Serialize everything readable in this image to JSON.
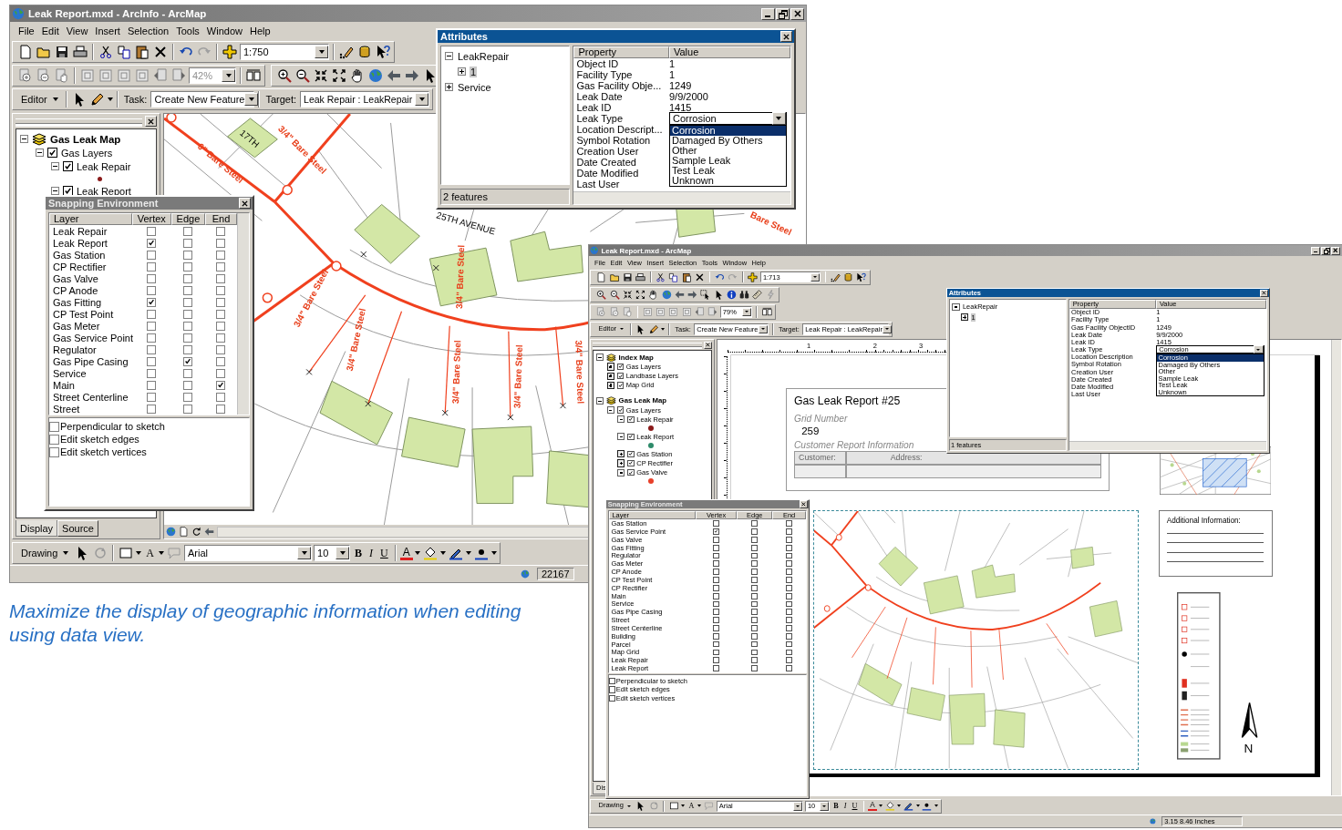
{
  "windows": [
    {
      "kind": "data",
      "title": "Leak Report.mxd - ArcInfo - ArcMap",
      "menu": [
        "File",
        "Edit",
        "View",
        "Insert",
        "Selection",
        "Tools",
        "Window",
        "Help"
      ],
      "scale": "1:750",
      "zoom": "42%",
      "editor": {
        "menu": "Editor",
        "task_label": "Task:",
        "task": "Create New Feature",
        "target_label": "Target:",
        "target": "Leak Repair : LeakRepair"
      },
      "toc": {
        "items": [
          {
            "kind": "frame",
            "label": "Gas Leak Map",
            "expanded": true,
            "children": [
              {
                "kind": "layer",
                "label": "Gas Layers",
                "checked": true,
                "expanded": true,
                "children": [
                  {
                    "kind": "layer",
                    "label": "Leak Repair",
                    "checked": true,
                    "expanded": true,
                    "children": [
                      {
                        "kind": "symbol",
                        "color": "#8b1a1a"
                      }
                    ]
                  },
                  {
                    "kind": "layer",
                    "label": "Leak Report",
                    "checked": true,
                    "expanded": true
                  }
                ]
              }
            ]
          }
        ]
      },
      "toc_tabs": [
        {
          "label": "Display",
          "selected": true
        },
        {
          "label": "Source",
          "selected": false
        }
      ],
      "map_labels": [
        {
          "text": "6\" Bare Steel",
          "kind": "pipe"
        },
        {
          "text": "17TH",
          "kind": "street"
        },
        {
          "text": "3/4\" Bare Steel",
          "kind": "pipe"
        },
        {
          "text": "25TH AVENUE",
          "kind": "street"
        },
        {
          "text": "3/4\" Bare Steel",
          "kind": "pipe"
        },
        {
          "text": "3/4\" Bare Steel",
          "kind": "pipe"
        },
        {
          "text": "3/4\" Bare Steel",
          "kind": "pipe"
        },
        {
          "text": "3/4\" Bare Steel",
          "kind": "pipe"
        },
        {
          "text": "3/4\" Bare Steel",
          "kind": "pipe"
        },
        {
          "text": "3/4\" Bare Steel",
          "kind": "pipe"
        },
        {
          "text": "Bare Steel",
          "kind": "pipe"
        }
      ],
      "drawing": {
        "menu": "Drawing",
        "text_tool": "A",
        "font": "Arial",
        "size": "10",
        "bold": "B",
        "italic": "I",
        "underline": "U",
        "font_color": "A"
      },
      "status": "22167",
      "attributes": {
        "title": "Attributes",
        "tree": [
          {
            "label": "LeakRepair",
            "expanded": true,
            "selected": false,
            "children": [
              {
                "label": "1",
                "expanded": false,
                "selected": true
              }
            ]
          },
          {
            "label": "Service",
            "expanded": false,
            "selected": false
          }
        ],
        "count": "2 features",
        "columns": [
          "Property",
          "Value"
        ],
        "rows": [
          {
            "property": "Object ID",
            "kind": "text",
            "value": "1"
          },
          {
            "property": "Facility Type",
            "kind": "text",
            "value": "1"
          },
          {
            "property": "Gas Facility Obje...",
            "kind": "text",
            "value": "1249"
          },
          {
            "property": "Leak Date",
            "kind": "text",
            "value": "9/9/2000"
          },
          {
            "property": "Leak ID",
            "kind": "text",
            "value": "1415"
          },
          {
            "property": "Leak Type",
            "kind": "dropdown",
            "value": "Corrosion",
            "options": [
              {
                "label": "Corrosion",
                "selected": true
              },
              {
                "label": "Damaged By Others",
                "selected": false
              },
              {
                "label": "Other",
                "selected": false
              },
              {
                "label": "Sample Leak",
                "selected": false
              },
              {
                "label": "Test Leak",
                "selected": false
              },
              {
                "label": "Unknown",
                "selected": false
              }
            ]
          },
          {
            "property": "Location Descript...",
            "kind": "text"
          },
          {
            "property": "Symbol Rotation",
            "kind": "text"
          },
          {
            "property": "Creation User",
            "kind": "text"
          },
          {
            "property": "Date Created",
            "kind": "text"
          },
          {
            "property": "Date Modified",
            "kind": "text"
          },
          {
            "property": "Last User",
            "kind": "text"
          }
        ]
      },
      "snapping": {
        "title": "Snapping Environment",
        "columns": [
          "Layer",
          "Vertex",
          "Edge",
          "End"
        ],
        "rows": [
          {
            "layer": "Leak Repair",
            "vertex": false,
            "edge": false,
            "end": false
          },
          {
            "layer": "Leak Report",
            "vertex": true,
            "edge": false,
            "end": false
          },
          {
            "layer": "Gas Station",
            "vertex": false,
            "edge": false,
            "end": false
          },
          {
            "layer": "CP Rectifier",
            "vertex": false,
            "edge": false,
            "end": false
          },
          {
            "layer": "Gas Valve",
            "vertex": false,
            "edge": false,
            "end": false
          },
          {
            "layer": "CP Anode",
            "vertex": false,
            "edge": false,
            "end": false
          },
          {
            "layer": "Gas Fitting",
            "vertex": true,
            "edge": false,
            "end": false
          },
          {
            "layer": "CP Test Point",
            "vertex": false,
            "edge": false,
            "end": false
          },
          {
            "layer": "Gas Meter",
            "vertex": false,
            "edge": false,
            "end": false
          },
          {
            "layer": "Gas Service Point",
            "vertex": false,
            "edge": false,
            "end": false
          },
          {
            "layer": "Regulator",
            "vertex": false,
            "edge": false,
            "end": false
          },
          {
            "layer": "Gas Pipe Casing",
            "vertex": false,
            "edge": true,
            "end": false
          },
          {
            "layer": "Service",
            "vertex": false,
            "edge": false,
            "end": false
          },
          {
            "layer": "Main",
            "vertex": false,
            "edge": false,
            "end": true
          },
          {
            "layer": "Street Centerline",
            "vertex": false,
            "edge": false,
            "end": false
          },
          {
            "layer": "Street",
            "vertex": false,
            "edge": false,
            "end": false
          }
        ],
        "options": [
          {
            "label": "Perpendicular to sketch",
            "checked": false
          },
          {
            "label": "Edit sketch edges",
            "checked": false
          },
          {
            "label": "Edit sketch vertices",
            "checked": false
          }
        ]
      }
    },
    {
      "kind": "layout",
      "title": "Leak Report.mxd - ArcMap",
      "menu": [
        "File",
        "Edit",
        "View",
        "Insert",
        "Selection",
        "Tools",
        "Window",
        "Help"
      ],
      "scale": "1:713",
      "zoom": "79%",
      "editor": {
        "menu": "Editor",
        "task_label": "Task:",
        "task": "Create New Feature",
        "target_label": "Target:",
        "target": "Leak Repair : LeakRepair"
      },
      "toc": {
        "items": [
          {
            "kind": "frame",
            "label": "Index Map",
            "expanded": true,
            "children": [
              {
                "kind": "layer",
                "label": "Gas Layers",
                "checked": true,
                "expanded": false
              },
              {
                "kind": "layer",
                "label": "Landbase Layers",
                "checked": true,
                "expanded": false
              },
              {
                "kind": "layer",
                "label": "Map Grid",
                "checked": true,
                "expanded": false
              }
            ]
          },
          {
            "kind": "frame",
            "label": "Gas Leak Map",
            "expanded": true,
            "children": [
              {
                "kind": "layer",
                "label": "Gas Layers",
                "checked": true,
                "expanded": true,
                "children": [
                  {
                    "kind": "layer",
                    "label": "Leak Repair",
                    "checked": true,
                    "expanded": true,
                    "children": [
                      {
                        "kind": "symbol",
                        "color": "#8b1a1a"
                      }
                    ]
                  },
                  {
                    "kind": "layer",
                    "label": "Leak Report",
                    "checked": true,
                    "expanded": true,
                    "children": [
                      {
                        "kind": "symbol",
                        "color": "#2e8b6a"
                      }
                    ]
                  },
                  {
                    "kind": "layer",
                    "label": "Gas Station",
                    "checked": true,
                    "expanded": false
                  },
                  {
                    "kind": "layer",
                    "label": "CP Rectifier",
                    "checked": true,
                    "expanded": false
                  },
                  {
                    "kind": "layer",
                    "label": "Gas Valve",
                    "checked": true,
                    "expanded": true,
                    "children": [
                      {
                        "kind": "symbol",
                        "color": "#e8402a"
                      }
                    ]
                  }
                ]
              }
            ]
          }
        ]
      },
      "toc_tabs": [
        {
          "label": "Dis",
          "selected": true
        }
      ],
      "layout": {
        "ruler": [
          "1",
          "2",
          "3"
        ],
        "title": "Gas Leak Report #25",
        "grid_label": "Grid Number",
        "grid_number": "259",
        "section": "Customer Report Information",
        "table": [
          "Customer:",
          "Address:"
        ],
        "additional": "Additional Information:",
        "north": "N"
      },
      "drawing": {
        "menu": "Drawing",
        "text_tool": "A",
        "font": "Arial",
        "size": "10",
        "bold": "B",
        "italic": "I",
        "underline": "U",
        "font_color": "A"
      },
      "status": "3.15  8.46 Inches",
      "attributes": {
        "title": "Attributes",
        "tree": [
          {
            "label": "LeakRepair",
            "expanded": true,
            "selected": false,
            "children": [
              {
                "label": "1",
                "expanded": false,
                "selected": true
              }
            ]
          }
        ],
        "count": "1 features",
        "columns": [
          "Property",
          "Value"
        ],
        "rows": [
          {
            "property": "Object ID",
            "kind": "text",
            "value": "1"
          },
          {
            "property": "Facility Type",
            "kind": "text",
            "value": "1"
          },
          {
            "property": "Gas Facility ObjectID",
            "kind": "text",
            "value": "1249"
          },
          {
            "property": "Leak Date",
            "kind": "text",
            "value": "9/9/2000"
          },
          {
            "property": "Leak ID",
            "kind": "text",
            "value": "1415"
          },
          {
            "property": "Leak Type",
            "kind": "dropdown",
            "value": "Corrosion",
            "options": [
              {
                "label": "Corrosion",
                "selected": true
              },
              {
                "label": "Damaged By Others",
                "selected": false
              },
              {
                "label": "Other",
                "selected": false
              },
              {
                "label": "Sample Leak",
                "selected": false
              },
              {
                "label": "Test Leak",
                "selected": false
              },
              {
                "label": "Unknown",
                "selected": false
              }
            ]
          },
          {
            "property": "Location Description",
            "kind": "text"
          },
          {
            "property": "Symbol Rotation",
            "kind": "text"
          },
          {
            "property": "Creation User",
            "kind": "text"
          },
          {
            "property": "Date Created",
            "kind": "text"
          },
          {
            "property": "Date Modified",
            "kind": "text"
          },
          {
            "property": "Last User",
            "kind": "text"
          }
        ]
      },
      "snapping": {
        "title": "Snapping Environment",
        "columns": [
          "Layer",
          "Vertex",
          "Edge",
          "End"
        ],
        "rows": [
          {
            "layer": "Gas Station",
            "vertex": false,
            "edge": false,
            "end": false
          },
          {
            "layer": "Gas Service Point",
            "vertex": true,
            "edge": false,
            "end": false
          },
          {
            "layer": "Gas Valve",
            "vertex": false,
            "edge": false,
            "end": false
          },
          {
            "layer": "Gas Fitting",
            "vertex": false,
            "edge": false,
            "end": false
          },
          {
            "layer": "Regulator",
            "vertex": false,
            "edge": false,
            "end": false
          },
          {
            "layer": "Gas Meter",
            "vertex": false,
            "edge": false,
            "end": false
          },
          {
            "layer": "CP Anode",
            "vertex": false,
            "edge": false,
            "end": false
          },
          {
            "layer": "CP Test Point",
            "vertex": false,
            "edge": false,
            "end": false
          },
          {
            "layer": "CP Rectifier",
            "vertex": false,
            "edge": false,
            "end": false
          },
          {
            "layer": "Main",
            "vertex": false,
            "edge": false,
            "end": false
          },
          {
            "layer": "Service",
            "vertex": false,
            "edge": false,
            "end": false
          },
          {
            "layer": "Gas Pipe Casing",
            "vertex": false,
            "edge": false,
            "end": false
          },
          {
            "layer": "Street",
            "vertex": false,
            "edge": false,
            "end": false
          },
          {
            "layer": "Street Centerline",
            "vertex": false,
            "edge": false,
            "end": false
          },
          {
            "layer": "Building",
            "vertex": false,
            "edge": false,
            "end": false
          },
          {
            "layer": "Parcel",
            "vertex": false,
            "edge": false,
            "end": false
          },
          {
            "layer": "Map Grid",
            "vertex": false,
            "edge": false,
            "end": false
          },
          {
            "layer": "Leak Repair",
            "vertex": false,
            "edge": false,
            "end": false
          },
          {
            "layer": "Leak Report",
            "vertex": false,
            "edge": false,
            "end": false
          }
        ],
        "options": [
          {
            "label": "Perpendicular to sketch",
            "checked": false
          },
          {
            "label": "Edit sketch edges",
            "checked": false
          },
          {
            "label": "Edit sketch vertices",
            "checked": false
          }
        ]
      }
    }
  ],
  "caption": "Maximize the display of geographic information when editing using data view."
}
